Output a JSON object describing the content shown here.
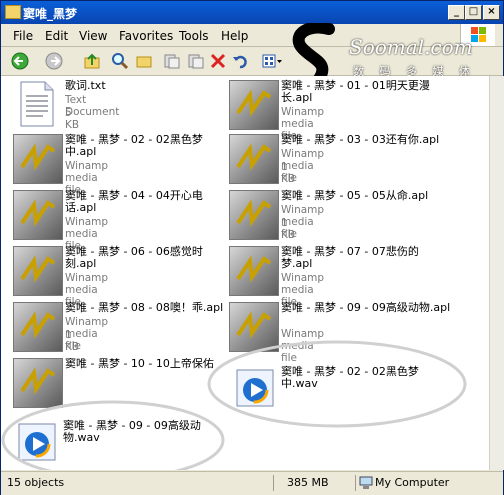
{
  "window": {
    "title": "窦唯_黑梦"
  },
  "menu": [
    {
      "label": "File"
    },
    {
      "label": "Edit"
    },
    {
      "label": "View"
    },
    {
      "label": "Favorites"
    },
    {
      "label": "Tools"
    },
    {
      "label": "Help"
    }
  ],
  "logo": {
    "brand": "Soomal.com",
    "tagline": "数 码 多 媒 体"
  },
  "files": [
    {
      "name": "歌词.txt",
      "type": "Text Document",
      "size": "5 KB",
      "icon": "text-document-icon"
    },
    {
      "name": "窦唯 - 黑梦 - 01 - 01明天更漫长.apl",
      "type": "Winamp media file",
      "size": "",
      "icon": "winamp-icon"
    },
    {
      "name": "窦唯 - 黑梦 - 02 - 02黑色梦中.apl",
      "type": "Winamp media file",
      "size": "",
      "icon": "winamp-icon"
    },
    {
      "name": "窦唯 - 黑梦 - 03 - 03还有你.apl",
      "type": "Winamp media file",
      "size": "1 KB",
      "icon": "winamp-icon"
    },
    {
      "name": "窦唯 - 黑梦 - 04 - 04开心电话.apl",
      "type": "Winamp media file",
      "size": "",
      "icon": "winamp-icon"
    },
    {
      "name": "窦唯 - 黑梦 - 05 - 05从命.apl",
      "type": "Winamp media file",
      "size": "1 KB",
      "icon": "winamp-icon"
    },
    {
      "name": "窦唯 - 黑梦 - 06 - 06感觉时刻.apl",
      "type": "Winamp media file",
      "size": "",
      "icon": "winamp-icon"
    },
    {
      "name": "窦唯 - 黑梦 - 07 - 07悲伤的梦.apl",
      "type": "Winamp media file",
      "size": "",
      "icon": "winamp-icon"
    },
    {
      "name": "窦唯 - 黑梦 - 08 - 08噢！乖.apl",
      "type": "Winamp media file",
      "size": "1 KB",
      "icon": "winamp-icon"
    },
    {
      "name": "窦唯 - 黑梦 - 09 - 09高级动物.apl",
      "type": "Winamp media file",
      "size": "",
      "icon": "winamp-icon"
    },
    {
      "name": "窦唯 - 黑梦 - 10 - 10上帝保佑",
      "type": "",
      "size": "",
      "icon": "winamp-icon"
    },
    {
      "name": "窦唯 - 黑梦 - 02 - 02黑色梦中.wav",
      "type": "",
      "size": "",
      "icon": "media-player-icon"
    },
    {
      "name": "窦唯 - 黑梦 - 09 - 09高级动物.wav",
      "type": "",
      "size": "",
      "icon": "media-player-icon"
    }
  ],
  "status": {
    "count": "15 objects",
    "size": "385 MB",
    "location": "My Computer"
  }
}
